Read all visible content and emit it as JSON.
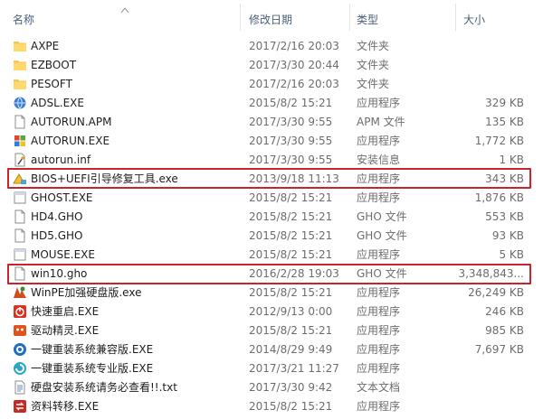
{
  "columns": {
    "name": "名称",
    "date": "修改日期",
    "type": "类型",
    "size": "大小"
  },
  "files": [
    {
      "name": "AXPE",
      "date": "2017/2/16 20:03",
      "type": "文件夹",
      "size": "",
      "icon": "folder-icon"
    },
    {
      "name": "EZBOOT",
      "date": "2017/3/30 20:44",
      "type": "文件夹",
      "size": "",
      "icon": "folder-icon"
    },
    {
      "name": "PESOFT",
      "date": "2017/2/16 20:03",
      "type": "文件夹",
      "size": "",
      "icon": "folder-icon"
    },
    {
      "name": "ADSL.EXE",
      "date": "2015/8/2 15:21",
      "type": "应用程序",
      "size": "329 KB",
      "icon": "network-app-icon"
    },
    {
      "name": "AUTORUN.APM",
      "date": "2017/3/30 9:55",
      "type": "APM 文件",
      "size": "135 KB",
      "icon": "document-icon"
    },
    {
      "name": "AUTORUN.EXE",
      "date": "2017/3/30 9:55",
      "type": "应用程序",
      "size": "1,772 KB",
      "icon": "windows-app-icon"
    },
    {
      "name": "autorun.inf",
      "date": "2017/3/30 9:55",
      "type": "安装信息",
      "size": "1 KB",
      "icon": "setup-info-icon"
    },
    {
      "name": "BIOS+UEFI引导修复工具.exe",
      "date": "2013/9/18 11:13",
      "type": "应用程序",
      "size": "343 KB",
      "icon": "repair-tool-icon"
    },
    {
      "name": "GHOST.EXE",
      "date": "2015/8/2 15:21",
      "type": "应用程序",
      "size": "1,876 KB",
      "icon": "blank-app-icon"
    },
    {
      "name": "HD4.GHO",
      "date": "2015/8/2 15:21",
      "type": "GHO 文件",
      "size": "553 KB",
      "icon": "document-icon"
    },
    {
      "name": "HD5.GHO",
      "date": "2015/8/2 15:21",
      "type": "GHO 文件",
      "size": "93 KB",
      "icon": "document-icon"
    },
    {
      "name": "MOUSE.EXE",
      "date": "2015/8/2 15:21",
      "type": "应用程序",
      "size": "5 KB",
      "icon": "blank-app-icon"
    },
    {
      "name": "win10.gho",
      "date": "2016/2/28 19:03",
      "type": "GHO 文件",
      "size": "3,348,843...",
      "icon": "document-icon"
    },
    {
      "name": "WinPE加强硬盘版.exe",
      "date": "2015/8/2 15:21",
      "type": "应用程序",
      "size": "26,249 KB",
      "icon": "winpe-icon"
    },
    {
      "name": "快速重启.EXE",
      "date": "2012/9/13 0:00",
      "type": "应用程序",
      "size": "246 KB",
      "icon": "restart-icon"
    },
    {
      "name": "驱动精灵.EXE",
      "date": "2015/8/2 15:21",
      "type": "应用程序",
      "size": "985 KB",
      "icon": "driver-icon"
    },
    {
      "name": "一键重装系统兼容版.EXE",
      "date": "2014/8/29 9:49",
      "type": "应用程序",
      "size": "7,697 KB",
      "icon": "reinstall-icon"
    },
    {
      "name": "一键重装系统专业版.EXE",
      "date": "2017/3/21 11:27",
      "type": "应用程序",
      "size": "",
      "icon": "reinstall-pro-icon"
    },
    {
      "name": "硬盘安装系统请务必查看!!.txt",
      "date": "2017/3/30 9:42",
      "type": "文本文档",
      "size": "",
      "icon": "text-file-icon"
    },
    {
      "name": "资料转移.EXE",
      "date": "2015/8/2 15:21",
      "type": "应用程序",
      "size": "",
      "icon": "transfer-icon"
    }
  ],
  "colors": {
    "highlight": "#c8242c",
    "header_text": "#4c607a",
    "folder": "#f4c653"
  }
}
